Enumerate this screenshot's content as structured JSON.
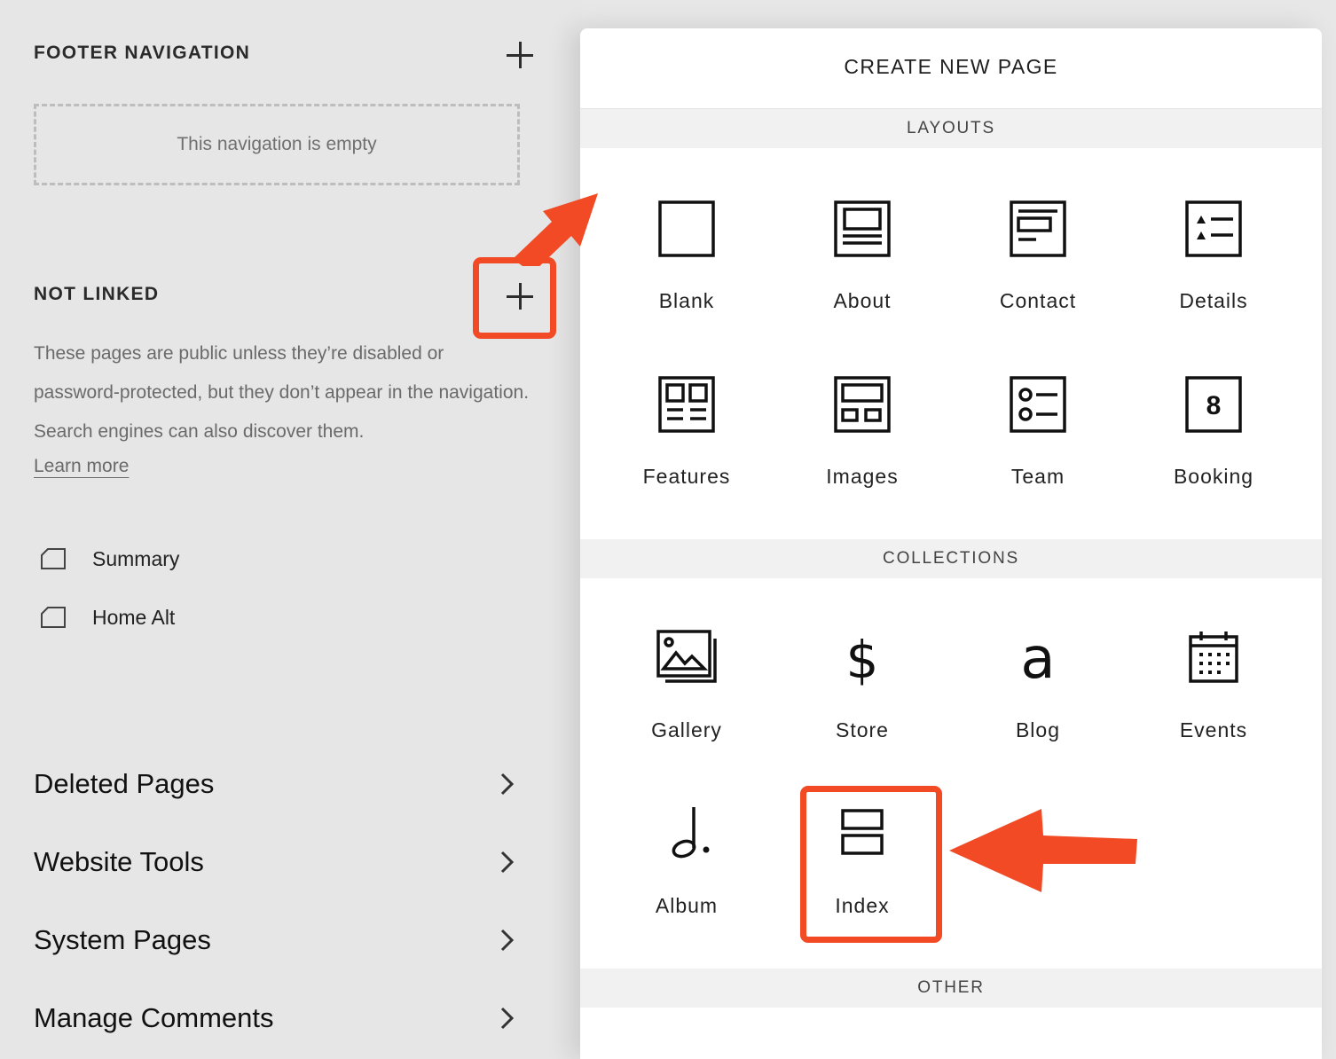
{
  "sidebar": {
    "footer_title": "FOOTER NAVIGATION",
    "empty_text": "This navigation is empty",
    "not_linked_title": "NOT LINKED",
    "description": "These pages are public unless they’re disabled or password-protected, but they don’t appear in the navigation. Search engines can also discover them.",
    "learn_more": "Learn more",
    "pages": [
      "Summary",
      "Home Alt"
    ],
    "nav": [
      "Deleted Pages",
      "Website Tools",
      "System Pages",
      "Manage Comments"
    ]
  },
  "panel": {
    "title": "CREATE NEW PAGE",
    "layouts_label": "LAYOUTS",
    "layouts": [
      "Blank",
      "About",
      "Contact",
      "Details",
      "Features",
      "Images",
      "Team",
      "Booking"
    ],
    "booking_icon_text": "8",
    "collections_label": "COLLECTIONS",
    "collections": [
      "Gallery",
      "Store",
      "Blog",
      "Events",
      "Album",
      "Index"
    ],
    "store_icon_glyph": "$",
    "blog_icon_glyph": "a",
    "other_label": "OTHER"
  },
  "colors": {
    "highlight": "#f24a25",
    "sidebar_bg": "#e6e6e6",
    "panel_bg": "#ffffff",
    "band_bg": "#f1f1f1"
  }
}
